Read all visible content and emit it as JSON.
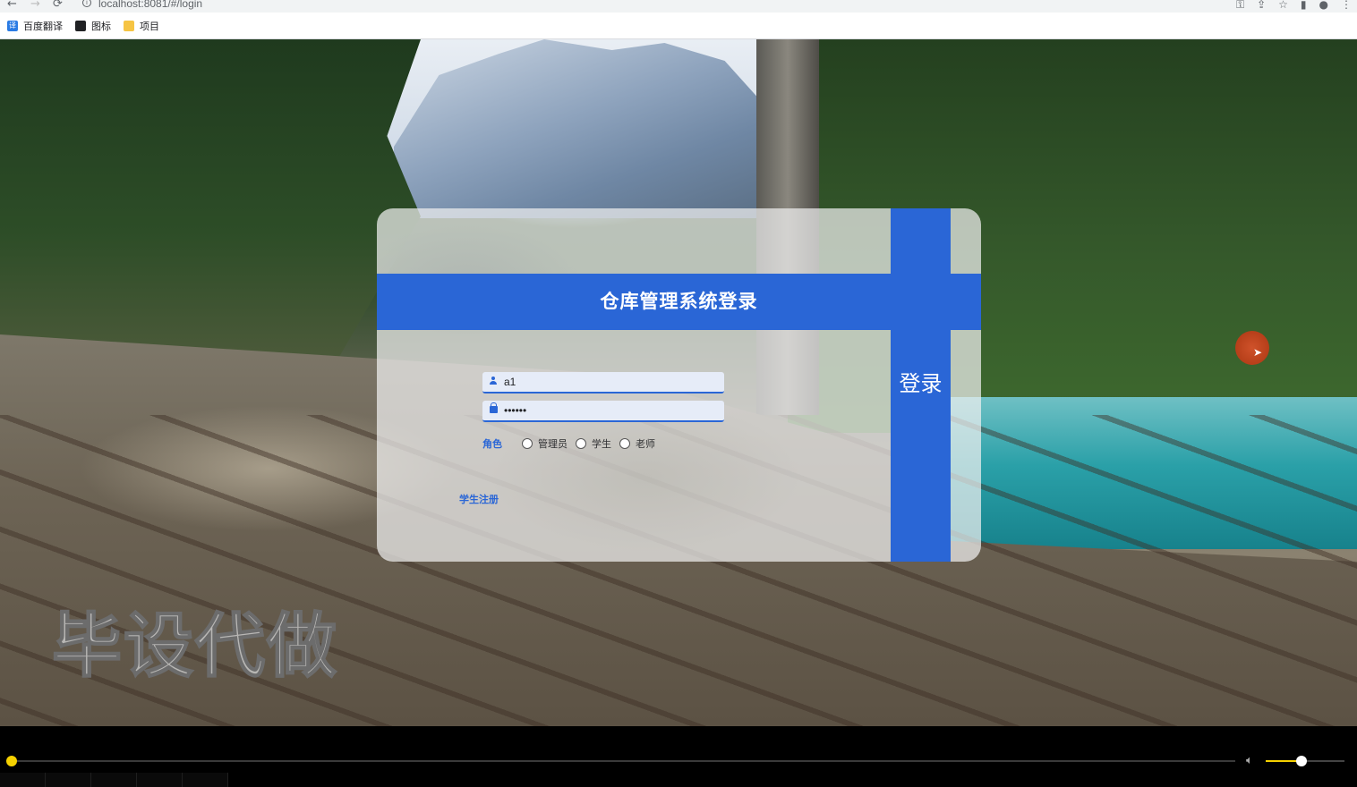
{
  "browser": {
    "url": "localhost:8081/#/login",
    "nav": {
      "back": "←",
      "forward": "→",
      "reload": "⟳"
    },
    "right_icons": [
      "key-icon",
      "share-icon",
      "star-icon",
      "sidebar-icon",
      "profile-icon",
      "menu-icon"
    ],
    "bookmarks": [
      {
        "label": "百度翻译",
        "icon": "translate-icon"
      },
      {
        "label": "图标",
        "icon": "image-icon"
      },
      {
        "label": "项目",
        "icon": "folder-icon"
      }
    ]
  },
  "login": {
    "title": "仓库管理系统登录",
    "username_value": "a1",
    "password_value": "••••••",
    "role_label": "角色",
    "roles": [
      "管理员",
      "学生",
      "老师"
    ],
    "register_link": "学生注册",
    "submit_label": "登录"
  },
  "watermark": "毕设代做",
  "colors": {
    "accent": "#2a66d6",
    "progress": "#f5d100"
  },
  "player": {
    "progress": 0.0,
    "volume": 0.45
  }
}
